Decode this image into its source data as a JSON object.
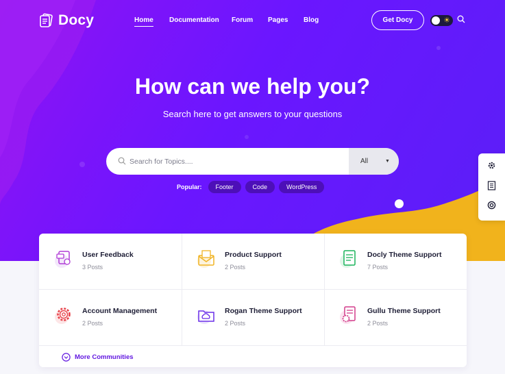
{
  "brand": {
    "name": "Docy"
  },
  "nav": {
    "items": [
      "Home",
      "Documentation",
      "Forum",
      "Pages",
      "Blog"
    ],
    "active": "Home"
  },
  "cta": {
    "label": "Get Docy"
  },
  "hero": {
    "title": "How can we help you?",
    "subtitle": "Search here to get answers to your questions"
  },
  "search": {
    "placeholder": "Search for Topics....",
    "filter_value": "All"
  },
  "popular": {
    "label": "Popular:",
    "tags": [
      "Footer",
      "Code",
      "WordPress"
    ]
  },
  "categories": [
    {
      "title": "User Feedback",
      "count": "3 Posts",
      "icon": "feedback-icon",
      "color": "#b03bd6"
    },
    {
      "title": "Product Support",
      "count": "2 Posts",
      "icon": "envelope-icon",
      "color": "#f0b323"
    },
    {
      "title": "Docly Theme Support",
      "count": "7 Posts",
      "icon": "document-icon",
      "color": "#19b35a"
    },
    {
      "title": "Account Management",
      "count": "2 Posts",
      "icon": "gear-icon",
      "color": "#e8434b"
    },
    {
      "title": "Rogan Theme Support",
      "count": "2 Posts",
      "icon": "folder-cloud-icon",
      "color": "#6a2ee8"
    },
    {
      "title": "Gullu Theme Support",
      "count": "2 Posts",
      "icon": "file-gear-icon",
      "color": "#d23c8a"
    }
  ],
  "more": {
    "label": "More Communities"
  },
  "colors": {
    "accent": "#6218e0",
    "hero": "#6b16ff",
    "wave": "#f1b31c"
  }
}
